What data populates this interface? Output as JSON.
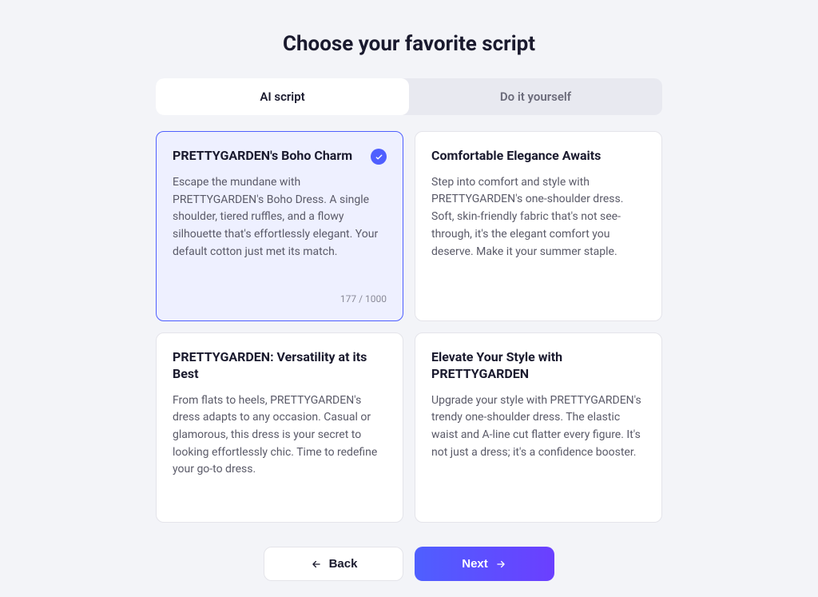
{
  "title": "Choose your favorite script",
  "tabs": {
    "ai": "AI script",
    "diy": "Do it yourself"
  },
  "cards": [
    {
      "title": "PRETTYGARDEN's Boho Charm",
      "body": "Escape the mundane with PRETTYGARDEN's Boho Dress. A single shoulder, tiered ruffles, and a flowy silhouette that's effortlessly elegant. Your default cotton just met its match.",
      "counter": "177 / 1000"
    },
    {
      "title": "Comfortable Elegance Awaits",
      "body": "Step into comfort and style with PRETTYGARDEN's one-shoulder dress. Soft, skin-friendly fabric that's not see-through, it's the elegant comfort you deserve. Make it your summer staple."
    },
    {
      "title": "PRETTYGARDEN: Versatility at its Best",
      "body": "From flats to heels, PRETTYGARDEN's dress adapts to any occasion. Casual or glamorous, this dress is your secret to looking effortlessly chic. Time to redefine your go-to dress."
    },
    {
      "title": "Elevate Your Style with PRETTYGARDEN",
      "body": "Upgrade your style with PRETTYGARDEN's trendy one-shoulder dress. The elastic waist and A-line cut flatter every figure. It's not just a dress; it's a confidence booster."
    }
  ],
  "buttons": {
    "back": "Back",
    "next": "Next"
  }
}
